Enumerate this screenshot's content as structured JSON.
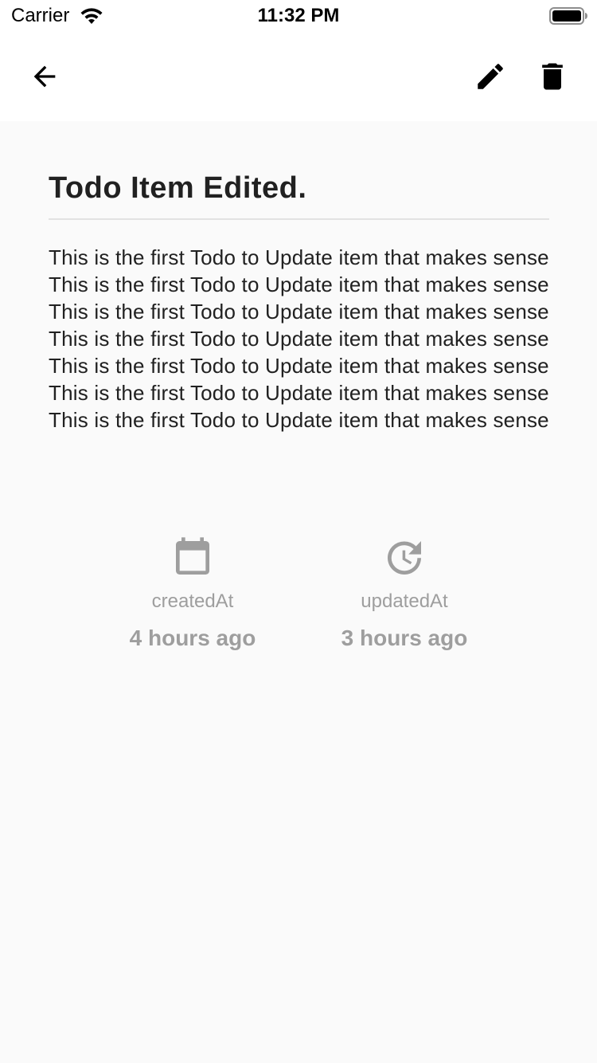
{
  "status_bar": {
    "carrier": "Carrier",
    "time": "11:32 PM",
    "icons": [
      "wifi-icon",
      "battery-icon"
    ]
  },
  "app_bar": {
    "actions": [
      {
        "name": "back",
        "icon": "arrow-left-icon"
      },
      {
        "name": "edit",
        "icon": "pencil-icon"
      },
      {
        "name": "delete",
        "icon": "trash-icon"
      }
    ]
  },
  "todo": {
    "title": "Todo Item Edited.",
    "description": "This is the first Todo to Update item that makes sense This is the first Todo to Update item that makes sense This is the first Todo to Update item that makes sense This is the first Todo to Update item that makes sense This is the first Todo to Update item that makes sense This is the first Todo to Update item that makes sense This is the first Todo to Update item that makes sense"
  },
  "meta": {
    "created": {
      "icon": "calendar-icon",
      "label": "createdAt",
      "value": "4 hours ago"
    },
    "updated": {
      "icon": "clock-update-icon",
      "label": "updatedAt",
      "value": "3 hours ago"
    }
  },
  "colors": {
    "background": "#fafafa",
    "app_bar": "#ffffff",
    "text_primary": "#212121",
    "text_muted": "#9e9e9e",
    "divider": "#e2e2e2"
  }
}
